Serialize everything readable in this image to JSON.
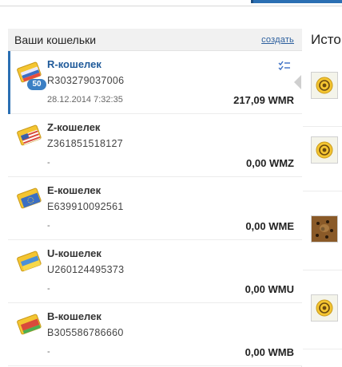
{
  "panel": {
    "title": "Ваши кошельки",
    "create_label": "создать"
  },
  "wallets": [
    {
      "name": "R-кошелек",
      "number": "R303279037006",
      "date": "28.12.2014 7:32:35",
      "amount": "217,09 WMR",
      "badge": "50",
      "icon": "r-wallet-icon",
      "color": "#e74c3c"
    },
    {
      "name": "Z-кошелек",
      "number": "Z361851518127",
      "date": "-",
      "amount": "0,00 WMZ",
      "icon": "z-wallet-icon",
      "color": "#f2a73b"
    },
    {
      "name": "E-кошелек",
      "number": "E639910092561",
      "date": "-",
      "amount": "0,00 WME",
      "icon": "e-wallet-icon",
      "color": "#3b6fc4"
    },
    {
      "name": "U-кошелек",
      "number": "U260124495373",
      "date": "-",
      "amount": "0,00 WMU",
      "icon": "u-wallet-icon",
      "color": "#4a90d9"
    },
    {
      "name": "B-кошелек",
      "number": "B305586786660",
      "date": "-",
      "amount": "0,00 WMB",
      "icon": "b-wallet-icon",
      "color": "#d94a3b"
    }
  ],
  "history": {
    "title_fragment": "Исто",
    "items": [
      {
        "icon": "webmoney-logo-icon"
      },
      {
        "icon": "webmoney-logo-icon"
      },
      {
        "icon": "leopard-avatar"
      },
      {
        "icon": "webmoney-logo-icon"
      }
    ]
  }
}
